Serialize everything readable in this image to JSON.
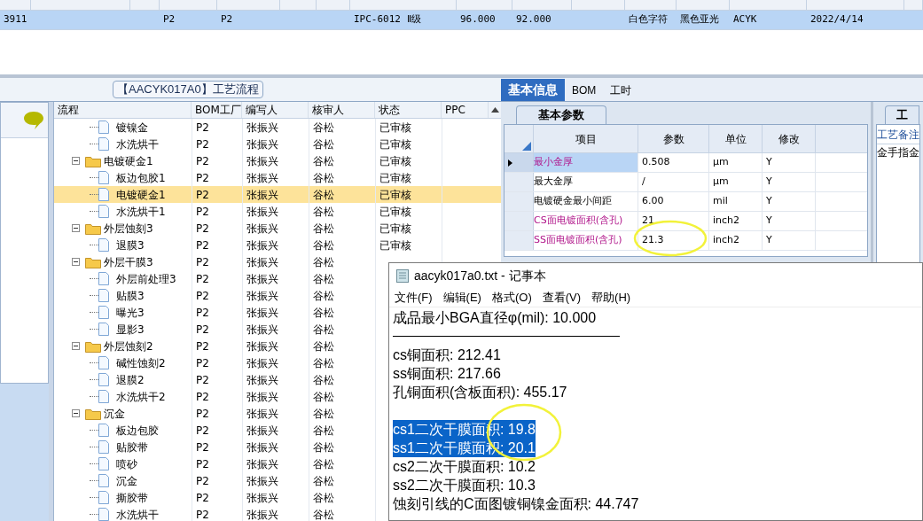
{
  "top_grid": {
    "row": {
      "selected": true,
      "cells": [
        "3911",
        "P2",
        "P2",
        "IPC-6012 Ⅱ级",
        "96.000",
        "92.000",
        "白色字符",
        "黑色亚光",
        "ACYK",
        "2022/4/14"
      ]
    }
  },
  "flow_panel": {
    "title": "【AACYK017A0】工艺流程",
    "columns": [
      "流程",
      "BOM工厂",
      "编写人",
      "核审人",
      "状态",
      "PPC"
    ],
    "tree": [
      {
        "kind": "file",
        "name": "镀镍金",
        "factory": "P2",
        "writer": "张振兴",
        "reviewer": "谷松",
        "status": "已审核",
        "selected": false
      },
      {
        "kind": "file",
        "name": "水洗烘干",
        "factory": "P2",
        "writer": "张振兴",
        "reviewer": "谷松",
        "status": "已审核",
        "selected": false
      },
      {
        "kind": "folder",
        "name": "电镀硬金1",
        "factory": "P2",
        "writer": "张振兴",
        "reviewer": "谷松",
        "status": "已审核",
        "selected": false,
        "expanded": true,
        "children": [
          {
            "kind": "file",
            "name": "板边包胶1",
            "factory": "P2",
            "writer": "张振兴",
            "reviewer": "谷松",
            "status": "已审核",
            "selected": false
          },
          {
            "kind": "file",
            "name": "电镀硬金1",
            "factory": "P2",
            "writer": "张振兴",
            "reviewer": "谷松",
            "status": "已审核",
            "selected": true
          },
          {
            "kind": "file",
            "name": "水洗烘干1",
            "factory": "P2",
            "writer": "张振兴",
            "reviewer": "谷松",
            "status": "已审核",
            "selected": false
          }
        ]
      },
      {
        "kind": "folder",
        "name": "外层蚀刻3",
        "factory": "P2",
        "writer": "张振兴",
        "reviewer": "谷松",
        "status": "已审核",
        "selected": false,
        "expanded": true,
        "children": [
          {
            "kind": "file",
            "name": "退膜3",
            "factory": "P2",
            "writer": "张振兴",
            "reviewer": "谷松",
            "status": "已审核",
            "selected": false
          }
        ]
      },
      {
        "kind": "folder",
        "name": "外层干膜3",
        "factory": "P2",
        "writer": "张振兴",
        "reviewer": "谷松",
        "selected": false,
        "expanded": true,
        "children": [
          {
            "kind": "file",
            "name": "外层前处理3",
            "factory": "P2",
            "writer": "张振兴",
            "reviewer": "谷松",
            "selected": false
          },
          {
            "kind": "file",
            "name": "贴膜3",
            "factory": "P2",
            "writer": "张振兴",
            "reviewer": "谷松",
            "selected": false
          },
          {
            "kind": "file",
            "name": "曝光3",
            "factory": "P2",
            "writer": "张振兴",
            "reviewer": "谷松",
            "selected": false
          },
          {
            "kind": "file",
            "name": "显影3",
            "factory": "P2",
            "writer": "张振兴",
            "reviewer": "谷松",
            "selected": false
          }
        ]
      },
      {
        "kind": "folder",
        "name": "外层蚀刻2",
        "factory": "P2",
        "writer": "张振兴",
        "reviewer": "谷松",
        "selected": false,
        "expanded": true,
        "children": [
          {
            "kind": "file",
            "name": "碱性蚀刻2",
            "factory": "P2",
            "writer": "张振兴",
            "reviewer": "谷松",
            "selected": false
          },
          {
            "kind": "file",
            "name": "退膜2",
            "factory": "P2",
            "writer": "张振兴",
            "reviewer": "谷松",
            "selected": false
          },
          {
            "kind": "file",
            "name": "水洗烘干2",
            "factory": "P2",
            "writer": "张振兴",
            "reviewer": "谷松",
            "selected": false
          }
        ]
      },
      {
        "kind": "folder",
        "name": "沉金",
        "factory": "P2",
        "writer": "张振兴",
        "reviewer": "谷松",
        "selected": false,
        "expanded": true,
        "children": [
          {
            "kind": "file",
            "name": "板边包胶",
            "factory": "P2",
            "writer": "张振兴",
            "reviewer": "谷松",
            "selected": false
          },
          {
            "kind": "file",
            "name": "贴胶带",
            "factory": "P2",
            "writer": "张振兴",
            "reviewer": "谷松",
            "selected": false
          },
          {
            "kind": "file",
            "name": "喷砂",
            "factory": "P2",
            "writer": "张振兴",
            "reviewer": "谷松",
            "selected": false
          },
          {
            "kind": "file",
            "name": "沉金",
            "factory": "P2",
            "writer": "张振兴",
            "reviewer": "谷松",
            "selected": false
          },
          {
            "kind": "file",
            "name": "撕胶带",
            "factory": "P2",
            "writer": "张振兴",
            "reviewer": "谷松",
            "selected": false
          },
          {
            "kind": "file",
            "name": "水洗烘干",
            "factory": "P2",
            "writer": "张振兴",
            "reviewer": "谷松",
            "selected": false
          }
        ]
      }
    ]
  },
  "info_panel": {
    "tabs": [
      {
        "label": "基本信息",
        "selected": true
      },
      {
        "label": "BOM",
        "selected": false
      },
      {
        "label": "工时",
        "selected": false
      }
    ],
    "sub_tab": "基本参数",
    "columns": [
      "项目",
      "参数",
      "单位",
      "修改"
    ],
    "rows": [
      {
        "item": "最小金厚",
        "value": "0.508",
        "unit": "μm",
        "modify": "Y",
        "flagged": true,
        "selected": true
      },
      {
        "item": "最大金厚",
        "value": "/",
        "unit": "μm",
        "modify": "Y",
        "flagged": false,
        "selected": false
      },
      {
        "item": "电镀硬金最小间距",
        "value": "6.00",
        "unit": "mil",
        "modify": "Y",
        "flagged": false,
        "selected": false
      },
      {
        "item": "CS面电镀面积(含孔)",
        "value": "21",
        "unit": "inch2",
        "modify": "Y",
        "flagged": true,
        "selected": false
      },
      {
        "item": "SS面电镀面积(含孔)",
        "value": "21.3",
        "unit": "inch2",
        "modify": "Y",
        "flagged": true,
        "selected": false
      }
    ]
  },
  "remarks_panel": {
    "tab": "工",
    "label": "工艺备注",
    "text": "金手指金"
  },
  "notepad": {
    "title": "aacyk017a0.txt - 记事本",
    "menu": [
      "文件(F)",
      "编辑(E)",
      "格式(O)",
      "查看(V)",
      "帮助(H)"
    ],
    "lines": [
      {
        "kind": "text",
        "text": "成品最小BGA直径φ(mil):  10.000",
        "selected": false
      },
      {
        "kind": "rule"
      },
      {
        "kind": "text",
        "text": "cs铜面积: 212.41",
        "selected": false
      },
      {
        "kind": "text",
        "text": "ss铜面积: 217.66",
        "selected": false
      },
      {
        "kind": "text",
        "text": "孔铜面积(含板面积): 455.17",
        "selected": false
      },
      {
        "kind": "blank"
      },
      {
        "kind": "text",
        "text": "cs1二次干膜面积: 19.8",
        "selected": true
      },
      {
        "kind": "text",
        "text": "ss1二次干膜面积: 20.1",
        "selected": true
      },
      {
        "kind": "text",
        "text": "cs2二次干膜面积: 10.2",
        "selected": false
      },
      {
        "kind": "text",
        "text": "ss2二次干膜面积: 10.3",
        "selected": false
      },
      {
        "kind": "text",
        "text": "蚀刻引线的C面图镀铜镍金面积: 44.747",
        "selected": false
      }
    ]
  }
}
